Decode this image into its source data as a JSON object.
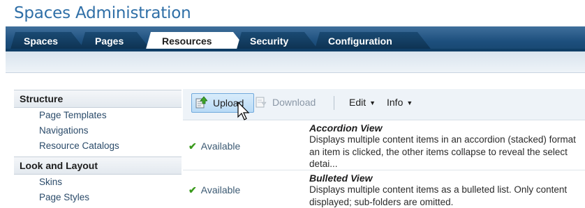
{
  "page": {
    "title": "Spaces Administration"
  },
  "tabs": [
    {
      "label": "Spaces",
      "active": false
    },
    {
      "label": "Pages",
      "active": false
    },
    {
      "label": "Resources",
      "active": true
    },
    {
      "label": "Security",
      "active": false
    },
    {
      "label": "Configuration",
      "active": false
    }
  ],
  "sidebar": {
    "sections": [
      {
        "title": "Structure",
        "items": [
          "Page Templates",
          "Navigations",
          "Resource Catalogs"
        ]
      },
      {
        "title": "Look and Layout",
        "items": [
          "Skins",
          "Page Styles"
        ]
      }
    ]
  },
  "toolbar": {
    "upload_label": "Upload",
    "download_label": "Download",
    "edit_label": "Edit",
    "info_label": "Info",
    "upload_icon": "upload-icon",
    "download_icon": "download-icon"
  },
  "rows": [
    {
      "status": "Available",
      "name": "Accordion View",
      "desc_lines": [
        "Displays multiple content items in an accordion (stacked) format",
        "an item is clicked, the other items collapse to reveal the select",
        "detai..."
      ]
    },
    {
      "status": "Available",
      "name": "Bulleted View",
      "desc_lines": [
        "Displays multiple content items as a bulleted list. Only content",
        "displayed; sub-folders are omitted."
      ]
    }
  ],
  "colors": {
    "brand_title": "#2f6fa7",
    "tabbar": "#1d4f7d",
    "check": "#3a9a1c",
    "upload_bg": "#b9dbf6"
  }
}
